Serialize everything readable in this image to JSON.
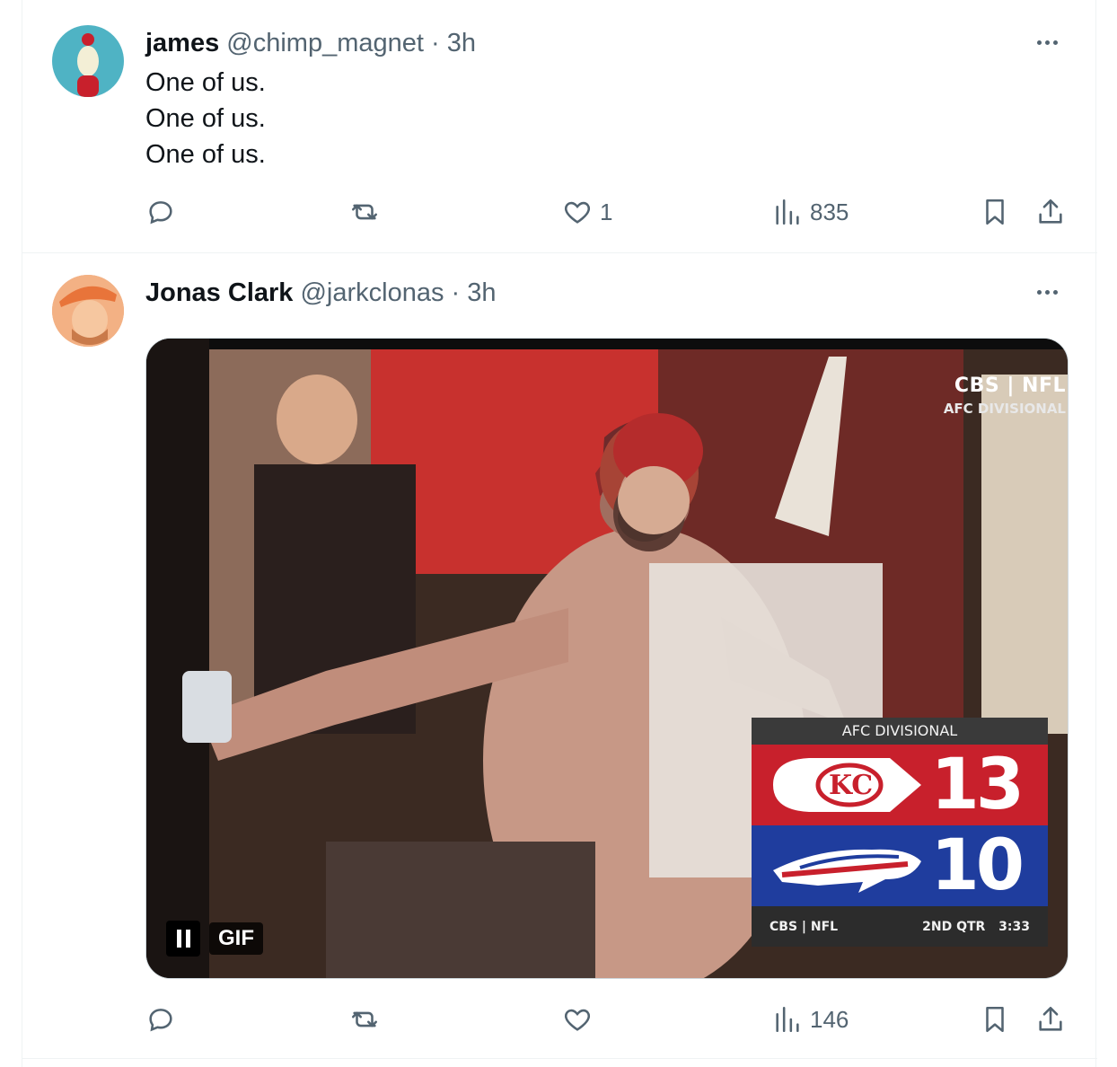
{
  "tweets": [
    {
      "name": "james",
      "handle": "@chimp_magnet",
      "separator": "·",
      "time": "3h",
      "lines": [
        "One of us.",
        "One of us.",
        "One of us."
      ],
      "likes": "1",
      "views": "835"
    },
    {
      "name": "Jonas Clark",
      "handle": "@jarkclonas",
      "separator": "·",
      "time": "3h",
      "likes": "",
      "views": "146",
      "media": {
        "gif_label": "GIF",
        "network_top": "CBS | NFL",
        "network_sub": "AFC DIVISIONAL",
        "scorebug": {
          "title": "AFC DIVISIONAL",
          "home_score": "13",
          "away_score": "10",
          "network": "CBS | NFL",
          "period": "2ND QTR",
          "clock": "3:33"
        }
      }
    }
  ],
  "icons": {
    "reply": "reply-icon",
    "retweet": "retweet-icon",
    "like": "heart-icon",
    "views": "views-icon",
    "bookmark": "bookmark-icon",
    "share": "share-icon",
    "more": "more-icon"
  },
  "colors": {
    "text_primary": "#0f1419",
    "text_secondary": "#536471",
    "divider": "#eff3f4",
    "chiefs_red": "#c8202c",
    "bills_blue": "#1f3d9e"
  }
}
